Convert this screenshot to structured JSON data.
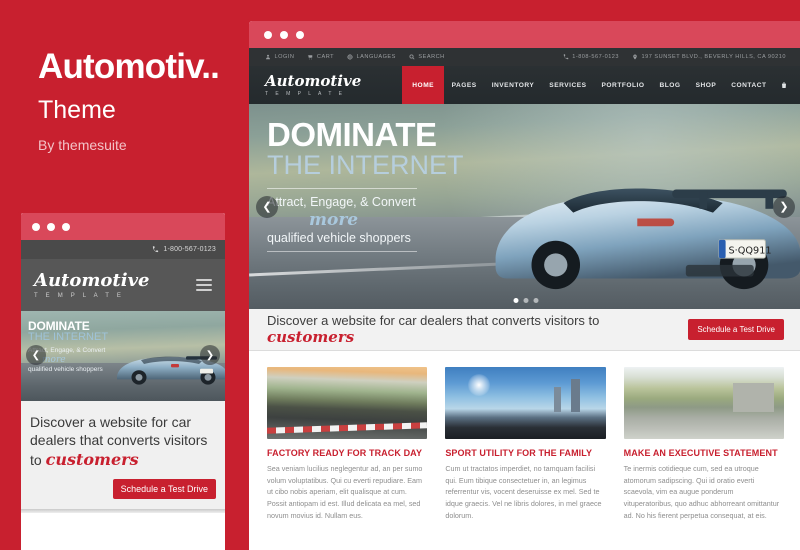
{
  "promo": {
    "title": "Automotiv..",
    "subtitle": "Theme",
    "author": "By themesuite",
    "brand_color": "#c8202f"
  },
  "mobile_preview": {
    "window_dots": 3,
    "topbar": {
      "phone": "1-800-567-0123",
      "phone_icon": "phone-icon"
    },
    "header": {
      "logo": "Automotive",
      "logo_sub": "T E M P L A T E",
      "menu_icon": "hamburger-menu-icon"
    },
    "hero": {
      "line1": "DOMINATE",
      "line2": "THE INTERNET",
      "line3": "Attract, Engage, & Convert",
      "line4": "more",
      "line5": "qualified vehicle shoppers",
      "prev_icon": "chevron-left-icon",
      "next_icon": "chevron-right-icon"
    },
    "callout": {
      "text": "Discover a website for car dealers that converts visitors to",
      "highlight": "customers",
      "button": "Schedule a Test Drive"
    }
  },
  "browser": {
    "window_dots": 3,
    "topbar": {
      "left_items": [
        {
          "icon": "user-icon",
          "label": "LOGIN"
        },
        {
          "icon": "cart-icon",
          "label": "CART"
        },
        {
          "icon": "globe-icon",
          "label": "LANGUAGES"
        },
        {
          "icon": "search-icon",
          "label": "SEARCH"
        }
      ],
      "right_items": [
        {
          "icon": "phone-icon",
          "label": "1-808-567-0123"
        },
        {
          "icon": "map-pin-icon",
          "label": "197 SUNSET BLVD., BEVERLY HILLS, CA 90210"
        }
      ]
    },
    "nav": {
      "logo": "Automotive",
      "logo_sub": "T E M P L A T E",
      "items": [
        {
          "label": "HOME",
          "active": true
        },
        {
          "label": "PAGES",
          "active": false
        },
        {
          "label": "INVENTORY",
          "active": false
        },
        {
          "label": "SERVICES",
          "active": false
        },
        {
          "label": "PORTFOLIO",
          "active": false
        },
        {
          "label": "BLOG",
          "active": false
        },
        {
          "label": "SHOP",
          "active": false
        },
        {
          "label": "CONTACT",
          "active": false
        }
      ],
      "cart_icon": "shopping-bag-icon"
    },
    "hero": {
      "line1": "DOMINATE",
      "line2": "THE INTERNET",
      "line3": "Attract, Engage, & Convert",
      "line4": "more",
      "line5": "qualified vehicle shoppers",
      "prev_icon": "chevron-left-icon",
      "next_icon": "chevron-right-icon",
      "slide_count": 3,
      "active_slide": 1
    },
    "callout": {
      "text": "Discover a website for car dealers that converts visitors to",
      "highlight": "customers",
      "button": "Schedule a Test Drive"
    },
    "cards": [
      {
        "image": "white-sports-car-on-racetrack",
        "title": "FACTORY READY FOR TRACK DAY",
        "body": "Sea veniam lucilius neglegentur ad, an per sumo volum voluptatibus. Qui cu everti repudiare. Eam ut cibo nobis aperiam, elit qualisque at cum. Possit antiopam id est. Illud delicata ea mel, sed novum movius id. Nullam eus."
      },
      {
        "image": "black-suv-by-city-waterfront",
        "title": "SPORT UTILITY FOR THE FAMILY",
        "body": "Cum ut tractatos imperdiet, no tamquam facilisi qui. Eum tibique consectetuer in, an legimus referrentur vis, vocent deseruisse ex mel. Sed te idque graecis. Vel ne libris dolores, in mel graece dolorum."
      },
      {
        "image": "red-sedan-on-scenic-overlook",
        "title": "MAKE AN EXECUTIVE STATEMENT",
        "body": "Te inermis cotidieque cum, sed ea utroque atomorum sadipscing. Qui id oratio everti scaevola, vim ea augue ponderum vituperatoribus, quo adhuc abhorreant omittantur ad. No his fierent perpetua consequat, at eis."
      }
    ]
  }
}
